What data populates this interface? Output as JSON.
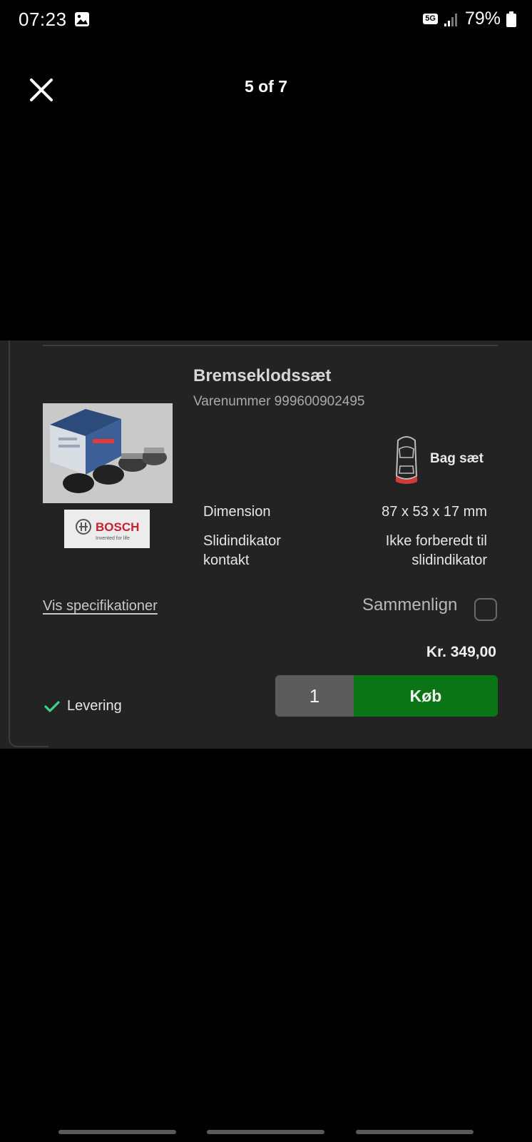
{
  "status_bar": {
    "time": "07:23",
    "network": "5G",
    "battery": "79%",
    "icons": [
      "gallery-icon",
      "signal-icon",
      "battery-icon"
    ]
  },
  "viewer": {
    "counter": "5 of 7",
    "close_icon": "close-icon"
  },
  "product": {
    "title": "Bremseklodssæt",
    "sku": "Varenummer 999600902495",
    "position": "Bag sæt",
    "brand": "BOSCH",
    "brand_tagline": "Invented for life",
    "specs": [
      {
        "label": "Dimension",
        "value": "87 x 53 x 17 mm"
      },
      {
        "label_line1": "Slidindikator",
        "label_line2": "kontakt",
        "value_line1": "Ikke forberedt til",
        "value_line2": "slidindikator"
      }
    ],
    "spec_link": "Vis specifikationer",
    "compare_label": "Sammenlign",
    "compare_checked": false,
    "price": "Kr. 349,00",
    "delivery": "Levering",
    "quantity": "1",
    "buy_label": "Køb"
  },
  "colors": {
    "buy_green": "#0b7414",
    "check_green": "#3fcf8e",
    "card_bg": "#232323",
    "brake_position_red": "#d33a3a"
  }
}
